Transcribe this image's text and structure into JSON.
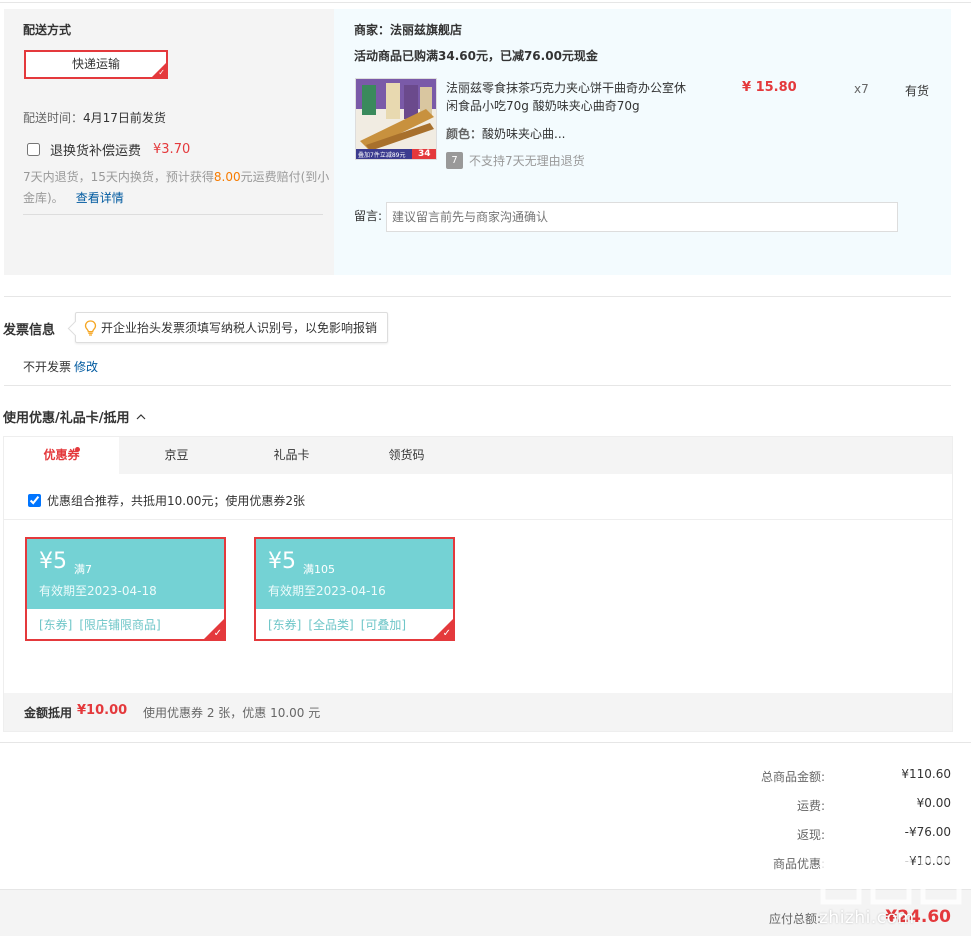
{
  "shipping": {
    "title": "配送方式",
    "method": "快递运输",
    "time_label": "配送时间：",
    "time_value": "4月17日前发货",
    "return_insurance_label": "退换货补偿运费",
    "return_insurance_price": "¥3.70",
    "note_part1": "7天内退货，15天内换货，预计获得",
    "note_highlight": "8.00",
    "note_part2": "元运费赔付(到小金库)。",
    "details_link": "查看详情"
  },
  "merchant": {
    "label": "商家：",
    "name": "法丽兹旗舰店",
    "promo": "活动商品已购满34.60元，已减76.00元现金",
    "product": {
      "name": "法丽兹零食抹茶巧克力夹心饼干曲奇办公室休闲食品小吃70g 酸奶味夹心曲奇70g",
      "price": "¥ 15.80",
      "qty": "x7",
      "stock": "有货",
      "color_label": "颜色：",
      "color_value": "酸奶味夹心曲...",
      "no7day_icon": "7",
      "no7day_text": "不支持7天无理由退货",
      "img_banner": "叠加7件立减89元",
      "img_price": "34"
    },
    "msg_label": "留言:",
    "msg_placeholder": "建议留言前先与商家沟通确认"
  },
  "invoice": {
    "title": "发票信息",
    "tip": "开企业抬头发票须填写纳税人识别号，以免影响报销",
    "status": "不开发票",
    "modify": "修改"
  },
  "coupons": {
    "title": "使用优惠/礼品卡/抵用",
    "tabs": [
      {
        "label": "优惠券"
      },
      {
        "label": "京豆"
      },
      {
        "label": "礼品卡"
      },
      {
        "label": "领货码"
      }
    ],
    "combo_text": "优惠组合推荐，共抵用10.00元；使用优惠券2张",
    "items": [
      {
        "amount": "¥5",
        "condition": "满7",
        "expiry": "有效期至2023-04-18",
        "tags": [
          "[东券]",
          "[限店铺限商品]"
        ]
      },
      {
        "amount": "¥5",
        "condition": "满105",
        "expiry": "有效期至2023-04-16",
        "tags": [
          "[东券]",
          "[全品类]",
          "[可叠加]"
        ]
      }
    ],
    "footer_label": "金额抵用",
    "footer_amount": "¥10.00",
    "footer_desc": "使用优惠券 2 张，优惠 10.00 元"
  },
  "totals": {
    "rows": [
      {
        "label": "总商品金额:",
        "value": "¥110.60"
      },
      {
        "label": "运费:",
        "value": "¥0.00"
      },
      {
        "label": "返现:",
        "value": "-¥76.00"
      },
      {
        "label": "商品优惠:",
        "value": "-¥10.00"
      }
    ],
    "payable_label": "应付总额:",
    "payable_value": "¥24.60"
  },
  "watermark": {
    "text": "zhizhi.com"
  },
  "colors": {
    "accent": "#e4393c",
    "link": "#005aa0",
    "coupon": "#74d2d4",
    "highlight": "#f77b00"
  }
}
